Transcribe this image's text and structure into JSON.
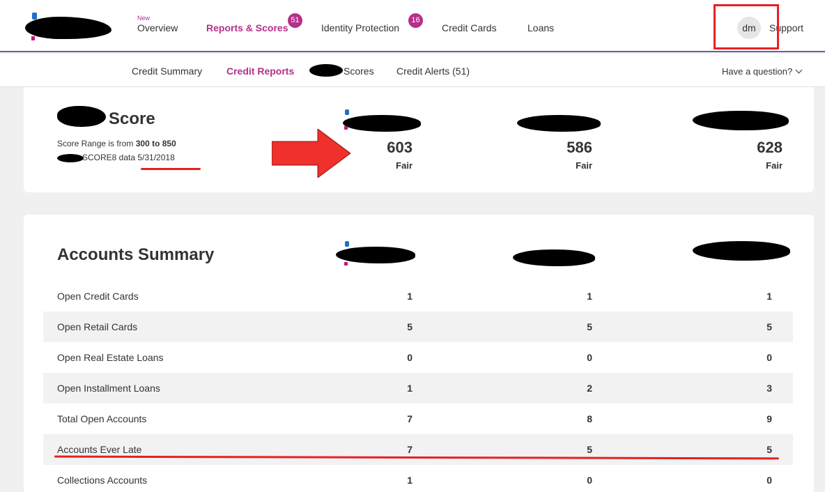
{
  "topnav": {
    "new_label": "New",
    "items": [
      {
        "label": "Overview"
      },
      {
        "label": "Reports & Scores",
        "badge": "51"
      },
      {
        "label": "Identity Protection",
        "badge": "16"
      },
      {
        "label": "Credit Cards"
      },
      {
        "label": "Loans"
      }
    ],
    "avatar": "dm",
    "support": "Support"
  },
  "subnav": {
    "items": [
      {
        "label": "Credit Summary"
      },
      {
        "label": "Credit Reports"
      },
      {
        "label": "Scores"
      },
      {
        "label": "Credit Alerts  (51)"
      }
    ],
    "question": "Have a question?"
  },
  "score_card": {
    "title": "Score",
    "range_prefix": "Score Range is from ",
    "range_value": "300 to 850",
    "data_label": "SCORE8 data 5/31/2018",
    "scores": [
      {
        "value": "603",
        "rating": "Fair"
      },
      {
        "value": "586",
        "rating": "Fair"
      },
      {
        "value": "628",
        "rating": "Fair"
      }
    ]
  },
  "summary": {
    "title": "Accounts Summary",
    "rows": [
      {
        "label": "Open Credit Cards",
        "values": [
          "1",
          "1",
          "1"
        ]
      },
      {
        "label": "Open Retail Cards",
        "values": [
          "5",
          "5",
          "5"
        ]
      },
      {
        "label": "Open Real Estate Loans",
        "values": [
          "0",
          "0",
          "0"
        ]
      },
      {
        "label": "Open Installment Loans",
        "values": [
          "1",
          "2",
          "3"
        ]
      },
      {
        "label": "Total Open Accounts",
        "values": [
          "7",
          "8",
          "9"
        ]
      },
      {
        "label": "Accounts Ever Late",
        "values": [
          "7",
          "5",
          "5"
        ]
      },
      {
        "label": "Collections Accounts",
        "values": [
          "1",
          "0",
          "0"
        ]
      }
    ]
  },
  "colors": {
    "accent": "#b52f8a",
    "annotation_red": "#e8201f"
  }
}
